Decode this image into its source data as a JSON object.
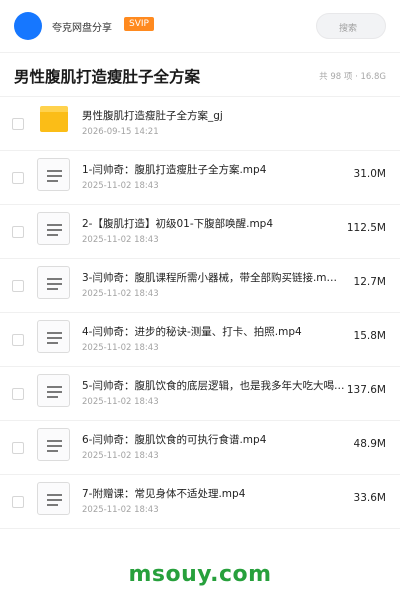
{
  "header": {
    "brand": "夸克网盘分享",
    "badge": "SVIP",
    "search_placeholder": "搜索"
  },
  "share": {
    "title": "男性腹肌打造瘦肚子全方案",
    "meta": "共 98 项 · 16.8G"
  },
  "files": [
    {
      "type": "folder",
      "icon": "folder-icon",
      "name": "男性腹肌打造瘦肚子全方案_gj",
      "date": "2026-09-15 14:21",
      "size": ""
    },
    {
      "type": "file",
      "icon": "document-icon",
      "name": "1-闫帅奇：腹肌打造瘦肚子全方案.mp4",
      "date": "2025-11-02 18:43",
      "size": "31.0M"
    },
    {
      "type": "file",
      "icon": "document-icon",
      "name": "2-【腹肌打造】初级01-下腹部唤醒.mp4",
      "date": "2025-11-02 18:43",
      "size": "112.5M"
    },
    {
      "type": "file",
      "icon": "document-icon",
      "name": "3-闫帅奇：腹肌课程所需小器械，带全部购买链接.m…",
      "date": "2025-11-02 18:43",
      "size": "12.7M"
    },
    {
      "type": "file",
      "icon": "document-icon",
      "name": "4-闫帅奇：进步的秘诀-测量、打卡、拍照.mp4",
      "date": "2025-11-02 18:43",
      "size": "15.8M"
    },
    {
      "type": "file",
      "icon": "document-icon",
      "name": "5-闫帅奇：腹肌饮食的底层逻辑，也是我多年大吃大喝…",
      "date": "2025-11-02 18:43",
      "size": "137.6M"
    },
    {
      "type": "file",
      "icon": "document-icon",
      "name": "6-闫帅奇：腹肌饮食的可执行食谱.mp4",
      "date": "2025-11-02 18:43",
      "size": "48.9M"
    },
    {
      "type": "file",
      "icon": "document-icon",
      "name": "7-附赠课：常见身体不适处理.mp4",
      "date": "2025-11-02 18:43",
      "size": "33.6M"
    }
  ],
  "watermark": "msouy.com",
  "colors": {
    "accent": "#1677ff",
    "badge": "#ff8a1f",
    "folder": "#fbbd17",
    "watermark": "#27a03c"
  }
}
